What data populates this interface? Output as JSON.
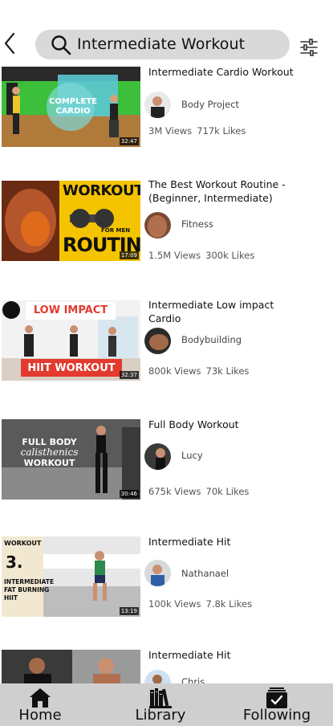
{
  "header": {
    "back_icon": "chevron-left-icon",
    "search_query": "Intermediate Workout",
    "search_icon": "search-icon",
    "filter_icon": "sliders-icon"
  },
  "videos": [
    {
      "title": "Intermediate Cardio Workout",
      "channel": "Body Project",
      "views": "3M Views",
      "likes": "717k Likes",
      "duration": "32:47",
      "thumb_text": [
        "COMPLETE",
        "CARDIO"
      ],
      "thumb_colors": [
        "#3cbf3a",
        "#5bc8d4"
      ]
    },
    {
      "title": "The Best Workout Routine - (Beginner, Intermediate)",
      "channel": "Fitness",
      "views": "1.5M Views",
      "likes": "300k Likes",
      "duration": "17:09",
      "thumb_text": [
        "WORKOUT",
        "FOR MEN",
        "ROUTINE"
      ],
      "thumb_colors": [
        "#f5c400",
        "#e06a1b"
      ]
    },
    {
      "title": "Intermediate Low impact Cardio",
      "channel": "Bodybuilding",
      "views": "800k Views",
      "likes": "73k Likes",
      "duration": "32:37",
      "thumb_text": [
        "LOW IMPACT",
        "HIIT WORKOUT"
      ],
      "thumb_colors": [
        "#e23a2e",
        "#f2f2f2"
      ]
    },
    {
      "title": "Full Body Workout",
      "channel": "Lucy",
      "views": "675k Views",
      "likes": "70k Likes",
      "duration": "30:46",
      "thumb_text": [
        "FULL BODY",
        "calisthenics",
        "WORKOUT"
      ],
      "thumb_colors": [
        "#5a5a5a",
        "#8a8a8a"
      ]
    },
    {
      "title": "Intermediate Hit",
      "channel": "Nathanael",
      "views": "100k Views",
      "likes": "7.8k Likes",
      "duration": "13:19",
      "thumb_text": [
        "WORKOUT",
        "3.",
        "INTERMEDIATE",
        "FAT BURNING",
        "HIIT"
      ],
      "thumb_colors": [
        "#f2e8d2",
        "#2a8a4a"
      ]
    },
    {
      "title": "Intermediate Hit",
      "channel": "Chris",
      "views": "",
      "likes": "",
      "duration": "",
      "thumb_text": [],
      "thumb_colors": [
        "#3a3a3a",
        "#9a9a9a"
      ]
    }
  ],
  "nav": {
    "home": {
      "label": "Home",
      "icon": "home-icon"
    },
    "library": {
      "label": "Library",
      "icon": "books-icon"
    },
    "following": {
      "label": "Following",
      "icon": "following-check-icon"
    }
  }
}
